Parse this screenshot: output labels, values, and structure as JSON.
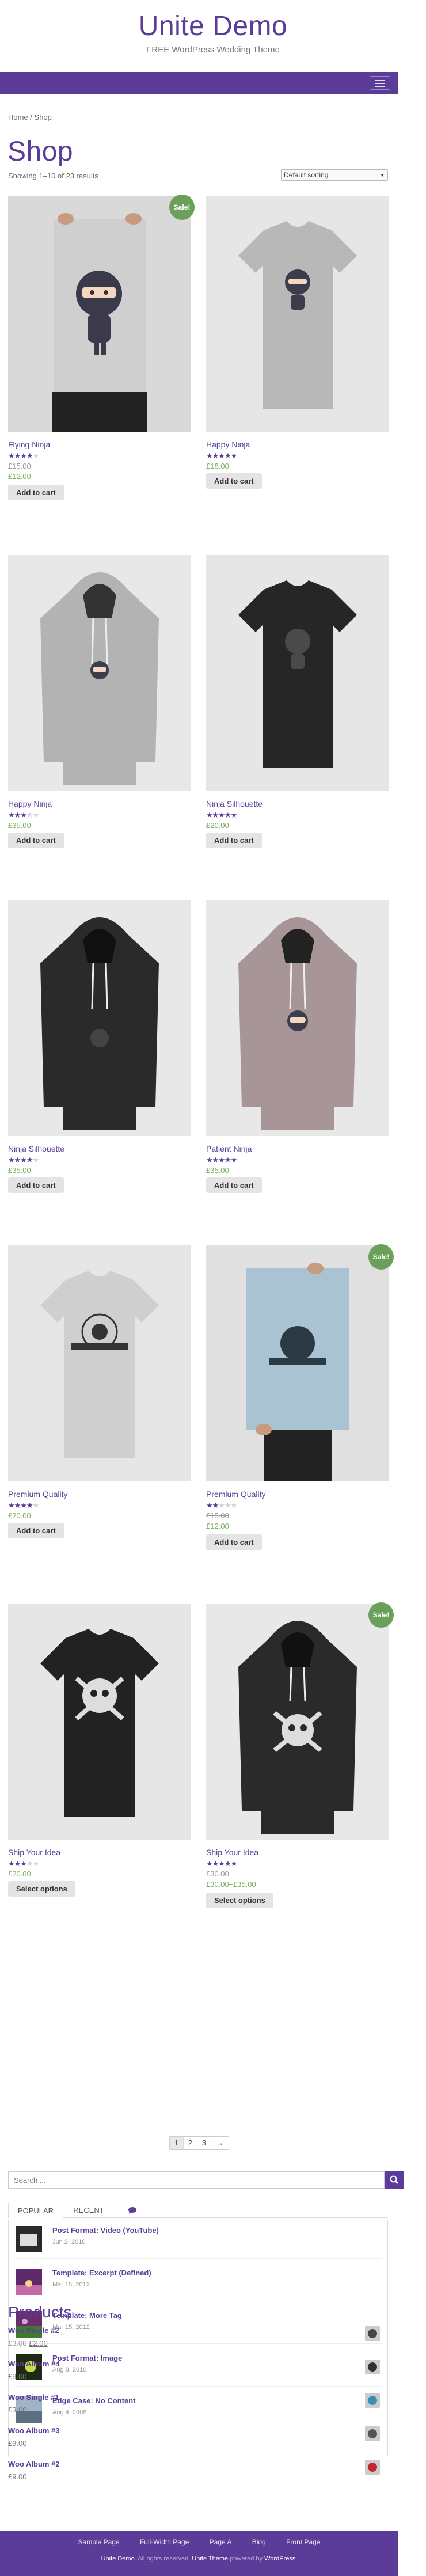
{
  "header": {
    "title": "Unite Demo",
    "tagline": "FREE WordPress Wedding Theme"
  },
  "breadcrumb": {
    "home": "Home",
    "sep": " / ",
    "current": "Shop"
  },
  "page": {
    "title": "Shop",
    "result_count": "Showing 1–10 of 23 results",
    "ordering": "Default sorting"
  },
  "colors": {
    "accent": "#5b3d99",
    "sale": "#6aa05a",
    "price": "#7db060"
  },
  "products": [
    {
      "name": "Flying Ninja",
      "rating": 4,
      "old_price": "£15.00",
      "price": "£12.00",
      "button": "Add to cart",
      "sale": "Sale!"
    },
    {
      "name": "Happy Ninja",
      "rating": 5,
      "price": "£18.00",
      "button": "Add to cart"
    },
    {
      "name": "Happy Ninja",
      "rating": 3,
      "price": "£35.00",
      "button": "Add to cart"
    },
    {
      "name": "Ninja Silhouette",
      "rating": 5,
      "price": "£20.00",
      "button": "Add to cart"
    },
    {
      "name": "Ninja Silhouette",
      "rating": 4,
      "price": "£35.00",
      "button": "Add to cart"
    },
    {
      "name": "Patient Ninja",
      "rating": 5,
      "price": "£35.00",
      "button": "Add to cart"
    },
    {
      "name": "Premium Quality",
      "rating": 4,
      "price": "£20.00",
      "button": "Add to cart"
    },
    {
      "name": "Premium Quality",
      "rating": 2,
      "old_price": "£15.00",
      "price": "£12.00",
      "button": "Add to cart",
      "sale": "Sale!"
    },
    {
      "name": "Ship Your Idea",
      "rating": 3,
      "price": "£20.00",
      "button": "Select options"
    },
    {
      "name": "Ship Your Idea",
      "rating": 5,
      "old_price": "£30.00",
      "price": "£30.00–£35.00",
      "button": "Select options",
      "sale": "Sale!"
    }
  ],
  "pagination": {
    "pages": [
      "1",
      "2",
      "3"
    ],
    "next": "→"
  },
  "search": {
    "placeholder": "Search ..."
  },
  "tabs": {
    "popular": "POPULAR",
    "recent": "RECENT"
  },
  "posts": [
    {
      "title": "Post Format: Video (YouTube)",
      "date": "Jun 2, 2010"
    },
    {
      "title": "Template: Excerpt (Defined)",
      "date": "Mar 15, 2012"
    },
    {
      "title": "Template: More Tag",
      "date": "Mar 15, 2012"
    },
    {
      "title": "Post Format: Image",
      "date": "Aug 8, 2010"
    },
    {
      "title": "Edge Case: No Content",
      "date": "Aug 4, 2008"
    }
  ],
  "product_widget": {
    "title": "Products",
    "items": [
      {
        "name": "Woo Single #2",
        "old_price": "£3.00",
        "price": "£2.00"
      },
      {
        "name": "Woo Album #4",
        "price": "£9.00"
      },
      {
        "name": "Woo Single #1",
        "price": "£3.00"
      },
      {
        "name": "Woo Album #3",
        "price": "£9.00"
      },
      {
        "name": "Woo Album #2",
        "price": "£9.00"
      }
    ]
  },
  "footer": {
    "nav": [
      "Sample Page",
      "Full-Width Page",
      "Page A",
      "Blog",
      "Front Page"
    ],
    "site": "Unite Demo",
    "rights": ". All rights reserved. ",
    "theme": "Unite Theme",
    "powered": " powered by ",
    "wp": "WordPress",
    "end": "."
  }
}
